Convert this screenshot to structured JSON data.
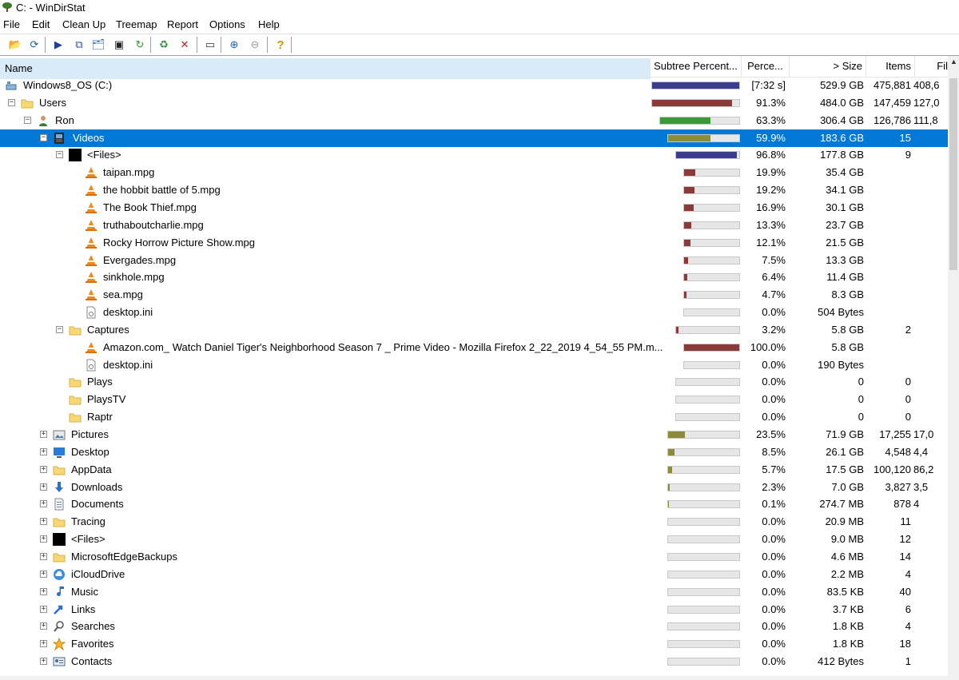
{
  "window": {
    "title": "C: - WinDirStat"
  },
  "menu": [
    "File",
    "Edit",
    "Clean Up",
    "Treemap",
    "Report",
    "Options",
    "Help"
  ],
  "toolbar": [
    {
      "icon": "open-folder-icon",
      "glyph": "📂",
      "color": "#b8860b"
    },
    {
      "icon": "refresh-all-icon",
      "glyph": "⟳",
      "color": "#1f5fa8"
    },
    {
      "icon": "play-icon",
      "glyph": "▶",
      "color": "#1f3f9a"
    },
    {
      "icon": "copy-path-icon",
      "glyph": "⧉",
      "color": "#2b4ea0"
    },
    {
      "icon": "explorer-icon",
      "glyph": "🗂",
      "color": "#3c6ea8"
    },
    {
      "icon": "command-prompt-icon",
      "glyph": "▣",
      "color": "#222222"
    },
    {
      "icon": "refresh-icon",
      "glyph": "↻",
      "color": "#2e9a2e"
    },
    {
      "icon": "recycle-bin-icon",
      "glyph": "♻",
      "color": "#2e8a3e"
    },
    {
      "icon": "delete-icon",
      "glyph": "✕",
      "color": "#d01818"
    },
    {
      "icon": "properties-icon",
      "glyph": "▭",
      "color": "#333333"
    },
    {
      "icon": "zoom-in-icon",
      "glyph": "⊕",
      "color": "#1f5fa8"
    },
    {
      "icon": "zoom-out-icon",
      "glyph": "⊖",
      "color": "#9a9a9a"
    },
    {
      "icon": "help-icon",
      "glyph": "?",
      "color": "#c89a00"
    }
  ],
  "columns": {
    "name": "Name",
    "subtree": "Subtree Percent...",
    "percent": "Perce...",
    "size": "> Size",
    "items": "Items",
    "files": "Fil"
  },
  "colors": {
    "selection": "#0078d7",
    "bar_bg": "#e6e6e6"
  },
  "rows": [
    {
      "name": "Windows8_OS (C:)",
      "level": 0,
      "expander": "",
      "icon": "drive-icon",
      "bar": 1.0,
      "bar_color": "#3b3b8f",
      "pct": "[7:32 s]",
      "size": "529.9 GB",
      "items": "475,881",
      "files": "408,6",
      "selected": false
    },
    {
      "name": "Users",
      "level": 1,
      "expander": "-",
      "icon": "folder-icon",
      "bar": 0.913,
      "bar_color": "#8b3a3a",
      "pct": "91.3%",
      "size": "484.0 GB",
      "items": "147,459",
      "files": "127,0",
      "selected": false
    },
    {
      "name": "Ron",
      "level": 2,
      "expander": "-",
      "icon": "user-icon",
      "bar": 0.633,
      "bar_color": "#3a9a3a",
      "pct": "63.3%",
      "size": "306.4 GB",
      "items": "126,786",
      "files": "111,8",
      "selected": false
    },
    {
      "name": "Videos",
      "level": 3,
      "expander": "-",
      "icon": "videos-folder-icon",
      "bar": 0.599,
      "bar_color": "#8b8b3a",
      "pct": "59.9%",
      "size": "183.6 GB",
      "items": "15",
      "files": "",
      "selected": true
    },
    {
      "name": "<Files>",
      "level": 4,
      "expander": "-",
      "icon": "files-block-icon",
      "bar": 0.968,
      "bar_color": "#3b3b8f",
      "pct": "96.8%",
      "size": "177.8 GB",
      "items": "9",
      "files": "",
      "selected": false
    },
    {
      "name": "taipan.mpg",
      "level": 5,
      "expander": "",
      "icon": "vlc-icon",
      "bar": 0.199,
      "bar_color": "#8b3a3a",
      "pct": "19.9%",
      "size": "35.4 GB",
      "items": "",
      "files": "",
      "selected": false
    },
    {
      "name": "the hobbit battle of 5.mpg",
      "level": 5,
      "expander": "",
      "icon": "vlc-icon",
      "bar": 0.192,
      "bar_color": "#8b3a3a",
      "pct": "19.2%",
      "size": "34.1 GB",
      "items": "",
      "files": "",
      "selected": false
    },
    {
      "name": "The Book Thief.mpg",
      "level": 5,
      "expander": "",
      "icon": "vlc-icon",
      "bar": 0.169,
      "bar_color": "#8b3a3a",
      "pct": "16.9%",
      "size": "30.1 GB",
      "items": "",
      "files": "",
      "selected": false
    },
    {
      "name": "truthaboutcharlie.mpg",
      "level": 5,
      "expander": "",
      "icon": "vlc-icon",
      "bar": 0.133,
      "bar_color": "#8b3a3a",
      "pct": "13.3%",
      "size": "23.7 GB",
      "items": "",
      "files": "",
      "selected": false
    },
    {
      "name": "Rocky Horrow Picture Show.mpg",
      "level": 5,
      "expander": "",
      "icon": "vlc-icon",
      "bar": 0.121,
      "bar_color": "#8b3a3a",
      "pct": "12.1%",
      "size": "21.5 GB",
      "items": "",
      "files": "",
      "selected": false
    },
    {
      "name": "Evergades.mpg",
      "level": 5,
      "expander": "",
      "icon": "vlc-icon",
      "bar": 0.075,
      "bar_color": "#8b3a3a",
      "pct": "7.5%",
      "size": "13.3 GB",
      "items": "",
      "files": "",
      "selected": false
    },
    {
      "name": "sinkhole.mpg",
      "level": 5,
      "expander": "",
      "icon": "vlc-icon",
      "bar": 0.064,
      "bar_color": "#8b3a3a",
      "pct": "6.4%",
      "size": "11.4 GB",
      "items": "",
      "files": "",
      "selected": false
    },
    {
      "name": "sea.mpg",
      "level": 5,
      "expander": "",
      "icon": "vlc-icon",
      "bar": 0.047,
      "bar_color": "#8b3a3a",
      "pct": "4.7%",
      "size": "8.3 GB",
      "items": "",
      "files": "",
      "selected": false
    },
    {
      "name": "desktop.ini",
      "level": 5,
      "expander": "",
      "icon": "ini-file-icon",
      "bar": 0.0,
      "bar_color": "#8b3a3a",
      "pct": "0.0%",
      "size": "504 Bytes",
      "items": "",
      "files": "",
      "selected": false
    },
    {
      "name": "Captures",
      "level": 4,
      "expander": "-",
      "icon": "folder-icon",
      "bar": 0.032,
      "bar_color": "#8b3a3a",
      "pct": "3.2%",
      "size": "5.8 GB",
      "items": "2",
      "files": "",
      "selected": false
    },
    {
      "name": "Amazon.com_ Watch Daniel Tiger's Neighborhood Season 7 _ Prime Video - Mozilla Firefox 2_22_2019 4_54_55 PM.m...",
      "level": 5,
      "expander": "",
      "icon": "vlc-icon",
      "bar": 1.0,
      "bar_color": "#8b3a3a",
      "pct": "100.0%",
      "size": "5.8 GB",
      "items": "",
      "files": "",
      "selected": false
    },
    {
      "name": "desktop.ini",
      "level": 5,
      "expander": "",
      "icon": "ini-file-icon",
      "bar": 0.0,
      "bar_color": "#8b3a3a",
      "pct": "0.0%",
      "size": "190 Bytes",
      "items": "",
      "files": "",
      "selected": false
    },
    {
      "name": "Plays",
      "level": 4,
      "expander": "",
      "icon": "folder-icon",
      "bar": 0.0,
      "bar_color": "#8b3a3a",
      "pct": "0.0%",
      "size": "0",
      "items": "0",
      "files": "",
      "selected": false
    },
    {
      "name": "PlaysTV",
      "level": 4,
      "expander": "",
      "icon": "folder-icon",
      "bar": 0.0,
      "bar_color": "#8b3a3a",
      "pct": "0.0%",
      "size": "0",
      "items": "0",
      "files": "",
      "selected": false
    },
    {
      "name": "Raptr",
      "level": 4,
      "expander": "",
      "icon": "folder-icon",
      "bar": 0.0,
      "bar_color": "#8b3a3a",
      "pct": "0.0%",
      "size": "0",
      "items": "0",
      "files": "",
      "selected": false
    },
    {
      "name": "Pictures",
      "level": 3,
      "expander": "+",
      "icon": "pictures-folder-icon",
      "bar": 0.235,
      "bar_color": "#8b8b3a",
      "pct": "23.5%",
      "size": "71.9 GB",
      "items": "17,255",
      "files": "17,0",
      "selected": false
    },
    {
      "name": "Desktop",
      "level": 3,
      "expander": "+",
      "icon": "desktop-folder-icon",
      "bar": 0.085,
      "bar_color": "#8b8b3a",
      "pct": "8.5%",
      "size": "26.1 GB",
      "items": "4,548",
      "files": "4,4",
      "selected": false
    },
    {
      "name": "AppData",
      "level": 3,
      "expander": "+",
      "icon": "folder-icon",
      "bar": 0.057,
      "bar_color": "#8b8b3a",
      "pct": "5.7%",
      "size": "17.5 GB",
      "items": "100,120",
      "files": "86,2",
      "selected": false
    },
    {
      "name": "Downloads",
      "level": 3,
      "expander": "+",
      "icon": "downloads-folder-icon",
      "bar": 0.023,
      "bar_color": "#8b8b3a",
      "pct": "2.3%",
      "size": "7.0 GB",
      "items": "3,827",
      "files": "3,5",
      "selected": false
    },
    {
      "name": "Documents",
      "level": 3,
      "expander": "+",
      "icon": "documents-folder-icon",
      "bar": 0.001,
      "bar_color": "#8b8b3a",
      "pct": "0.1%",
      "size": "274.7 MB",
      "items": "878",
      "files": "4",
      "selected": false
    },
    {
      "name": "Tracing",
      "level": 3,
      "expander": "+",
      "icon": "folder-icon",
      "bar": 0.0,
      "bar_color": "#8b8b3a",
      "pct": "0.0%",
      "size": "20.9 MB",
      "items": "11",
      "files": "",
      "selected": false
    },
    {
      "name": "<Files>",
      "level": 3,
      "expander": "+",
      "icon": "files-block-icon",
      "bar": 0.0,
      "bar_color": "#8b8b3a",
      "pct": "0.0%",
      "size": "9.0 MB",
      "items": "12",
      "files": "",
      "selected": false
    },
    {
      "name": "MicrosoftEdgeBackups",
      "level": 3,
      "expander": "+",
      "icon": "folder-icon",
      "bar": 0.0,
      "bar_color": "#8b8b3a",
      "pct": "0.0%",
      "size": "4.6 MB",
      "items": "14",
      "files": "",
      "selected": false
    },
    {
      "name": "iCloudDrive",
      "level": 3,
      "expander": "+",
      "icon": "icloud-icon",
      "bar": 0.0,
      "bar_color": "#8b8b3a",
      "pct": "0.0%",
      "size": "2.2 MB",
      "items": "4",
      "files": "",
      "selected": false
    },
    {
      "name": "Music",
      "level": 3,
      "expander": "+",
      "icon": "music-note-icon",
      "bar": 0.0,
      "bar_color": "#8b8b3a",
      "pct": "0.0%",
      "size": "83.5 KB",
      "items": "40",
      "files": "",
      "selected": false
    },
    {
      "name": "Links",
      "level": 3,
      "expander": "+",
      "icon": "links-icon",
      "bar": 0.0,
      "bar_color": "#8b8b3a",
      "pct": "0.0%",
      "size": "3.7 KB",
      "items": "6",
      "files": "",
      "selected": false
    },
    {
      "name": "Searches",
      "level": 3,
      "expander": "+",
      "icon": "search-icon",
      "bar": 0.0,
      "bar_color": "#8b8b3a",
      "pct": "0.0%",
      "size": "1.8 KB",
      "items": "4",
      "files": "",
      "selected": false
    },
    {
      "name": "Favorites",
      "level": 3,
      "expander": "+",
      "icon": "star-icon",
      "bar": 0.0,
      "bar_color": "#8b8b3a",
      "pct": "0.0%",
      "size": "1.8 KB",
      "items": "18",
      "files": "",
      "selected": false
    },
    {
      "name": "Contacts",
      "level": 3,
      "expander": "+",
      "icon": "contacts-icon",
      "bar": 0.0,
      "bar_color": "#8b8b3a",
      "pct": "0.0%",
      "size": "412 Bytes",
      "items": "1",
      "files": "",
      "selected": false
    }
  ]
}
